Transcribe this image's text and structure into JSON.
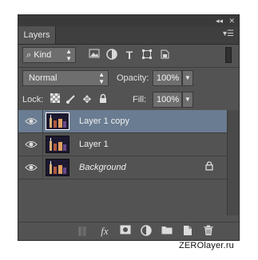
{
  "panel": {
    "tab_label": "Layers",
    "window_controls": {
      "collapse": "◂◂",
      "close": "✕"
    },
    "menu_icon": "panel-menu-icon"
  },
  "filter": {
    "kind_label": "Kind",
    "icons": [
      "image-filter-icon",
      "adjustment-filter-icon",
      "type-filter-icon",
      "shape-filter-icon",
      "smart-object-filter-icon"
    ]
  },
  "blend": {
    "mode": "Normal",
    "opacity_label": "Opacity:",
    "opacity_value": "100%",
    "fill_label": "Fill:",
    "fill_value": "100%"
  },
  "lock": {
    "label": "Lock:",
    "icons": [
      "lock-transparent-pixels-icon",
      "lock-image-pixels-icon",
      "lock-position-icon",
      "lock-all-icon"
    ]
  },
  "layers": [
    {
      "name": "Layer 1 copy",
      "selected": true,
      "italic": false,
      "locked": false
    },
    {
      "name": "Layer 1",
      "selected": false,
      "italic": false,
      "locked": false
    },
    {
      "name": "Background",
      "selected": false,
      "italic": true,
      "locked": true
    }
  ],
  "bottom_icons": [
    "link-layers-icon",
    "fx-icon",
    "add-mask-icon",
    "adjustment-layer-icon",
    "new-group-icon",
    "new-layer-icon",
    "delete-layer-icon"
  ],
  "watermark": "ZEROlayer.ru",
  "colors": {
    "panel_bg": "#535353",
    "selected_row": "#6a7c91",
    "field_bg": "#6e6e6e"
  }
}
